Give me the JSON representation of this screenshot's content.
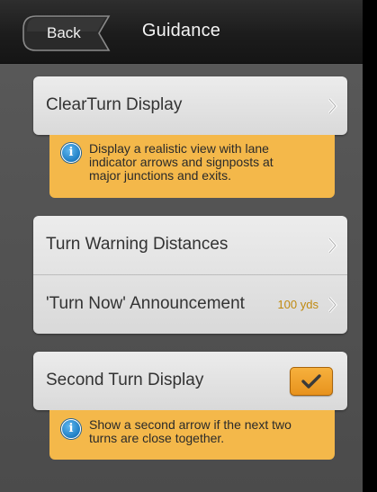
{
  "header": {
    "back_label": "Back",
    "title": "Guidance"
  },
  "groups": {
    "clearturn": {
      "label": "ClearTurn Display"
    },
    "clearturn_info": {
      "lines": [
        "Display a realistic view with lane",
        "indicator arrows and signposts at",
        "major junctions and exits."
      ]
    },
    "turn": {
      "warning_label": "Turn Warning Distances",
      "now_label": "'Turn Now' Announcement",
      "now_value": "100 yds"
    },
    "second": {
      "label": "Second Turn Display",
      "checked": true
    },
    "second_info": {
      "lines": [
        "Show a second arrow if the next two",
        "turns are close together."
      ]
    }
  },
  "icons": {
    "info": "i",
    "chevron": "chevron-right-icon",
    "check": "checkmark-icon"
  },
  "colors": {
    "accent_orange": "#f4b84a",
    "value_gold": "#c08a10",
    "info_blue": "#1f7ec4"
  }
}
